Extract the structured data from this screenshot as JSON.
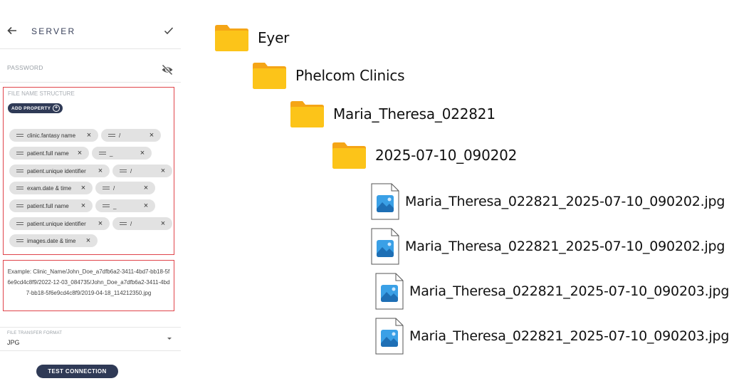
{
  "panel": {
    "title": "SERVER",
    "password_label": "PASSWORD",
    "file_name_structure": {
      "label": "FILE NAME STRUCTURE",
      "add_property_label": "ADD PROPERTY",
      "rows": [
        [
          {
            "label": "clinic.fantasy name"
          },
          {
            "label": "/"
          }
        ],
        [
          {
            "label": "patient.full name"
          },
          {
            "label": "_"
          }
        ],
        [
          {
            "label": "patient.unique identifier"
          },
          {
            "label": "/"
          }
        ],
        [
          {
            "label": "exam.date & time"
          },
          {
            "label": "/"
          }
        ],
        [
          {
            "label": "patient.full name"
          },
          {
            "label": "_"
          }
        ],
        [
          {
            "label": "patient.unique identifier"
          },
          {
            "label": "/"
          }
        ],
        [
          {
            "label": "images.date & time"
          }
        ]
      ]
    },
    "example_text": "Example: Clinic_Name/John_Doe_a7dfb6a2-3411-4bd7-bb18-5f6e9cd4c8f9/2022-12-03_084735/John_Doe_a7dfb6a2-3411-4bd7-bb18-5f6e9cd4c8f9/2019-04-18_114212350.jpg",
    "file_transfer_format": {
      "label": "FILE TRANSFER FORMAT",
      "value": "JPG"
    },
    "test_connection_label": "TEST CONNECTION"
  },
  "tree": {
    "folders": [
      {
        "name": "Eyer"
      },
      {
        "name": "Phelcom Clinics"
      },
      {
        "name": "Maria_Theresa_022821"
      },
      {
        "name": "2025-07-10_090202"
      }
    ],
    "files": [
      {
        "name": "Maria_Theresa_022821_2025-07-10_090202.jpg"
      },
      {
        "name": "Maria_Theresa_022821_2025-07-10_090202.jpg"
      },
      {
        "name": "Maria_Theresa_022821_2025-07-10_090203.jpg"
      },
      {
        "name": "Maria_Theresa_022821_2025-07-10_090203.jpg"
      }
    ]
  },
  "colors": {
    "accent": "#2f3a56",
    "highlight_border": "#e0454b",
    "chip": "#e2e2e2",
    "folder": "#fcc419",
    "image_icon": "#2b8fd6"
  },
  "icons": [
    "back-arrow-icon",
    "check-icon",
    "eye-off-icon",
    "plus-circle-icon",
    "drag-handle-icon",
    "close-icon",
    "dropdown-caret-icon",
    "folder-icon",
    "image-file-icon"
  ]
}
